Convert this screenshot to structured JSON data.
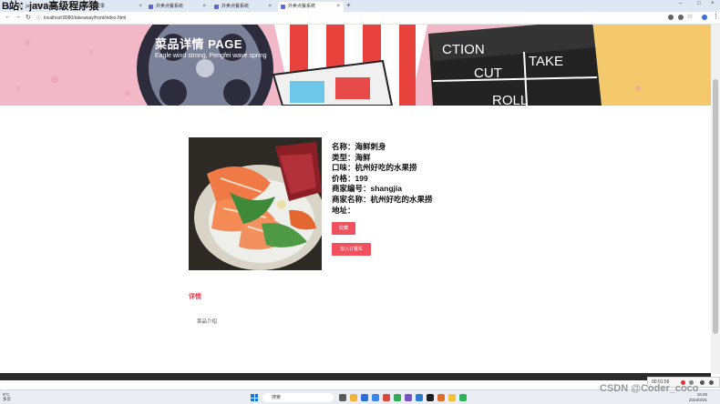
{
  "watermark_top": "B站：java高级程序猿",
  "tabs": [
    {
      "label": "B站：java高级程序猿"
    },
    {
      "label": "系统登录"
    },
    {
      "label": "外卖点餐系统"
    },
    {
      "label": "外卖点餐系统"
    },
    {
      "label": "外卖点餐系统"
    }
  ],
  "browser": {
    "url": "localhost:8080/takeaway/front/index.html"
  },
  "banner": {
    "title": "菜品详情 PAGE",
    "subtitle": "Eagle wind strong, Pengfei wave spring"
  },
  "dish": {
    "name_line": "名称：海鲜刺身",
    "type_line": "类型：海鲜",
    "taste_line": "口味：杭州好吃的水果捞",
    "price_line": "价格：199",
    "merchant_id_line": "商家编号：shangjia",
    "merchant_name_line": "商家名称：杭州好吃的水果捞",
    "address_line": "地址："
  },
  "buttons": {
    "collect": "收藏",
    "cart": "加入订餐车"
  },
  "detail": {
    "title": "详情",
    "text": "菜品介绍"
  },
  "taskbar": {
    "weather_temp": "9°C",
    "weather_desc": "多云",
    "search_placeholder": "搜索",
    "time": "16:25",
    "date": "2023/2/21"
  },
  "recorder": {
    "time": "00:01:59"
  },
  "watermark_bottom": "CSDN @Coder_coco"
}
